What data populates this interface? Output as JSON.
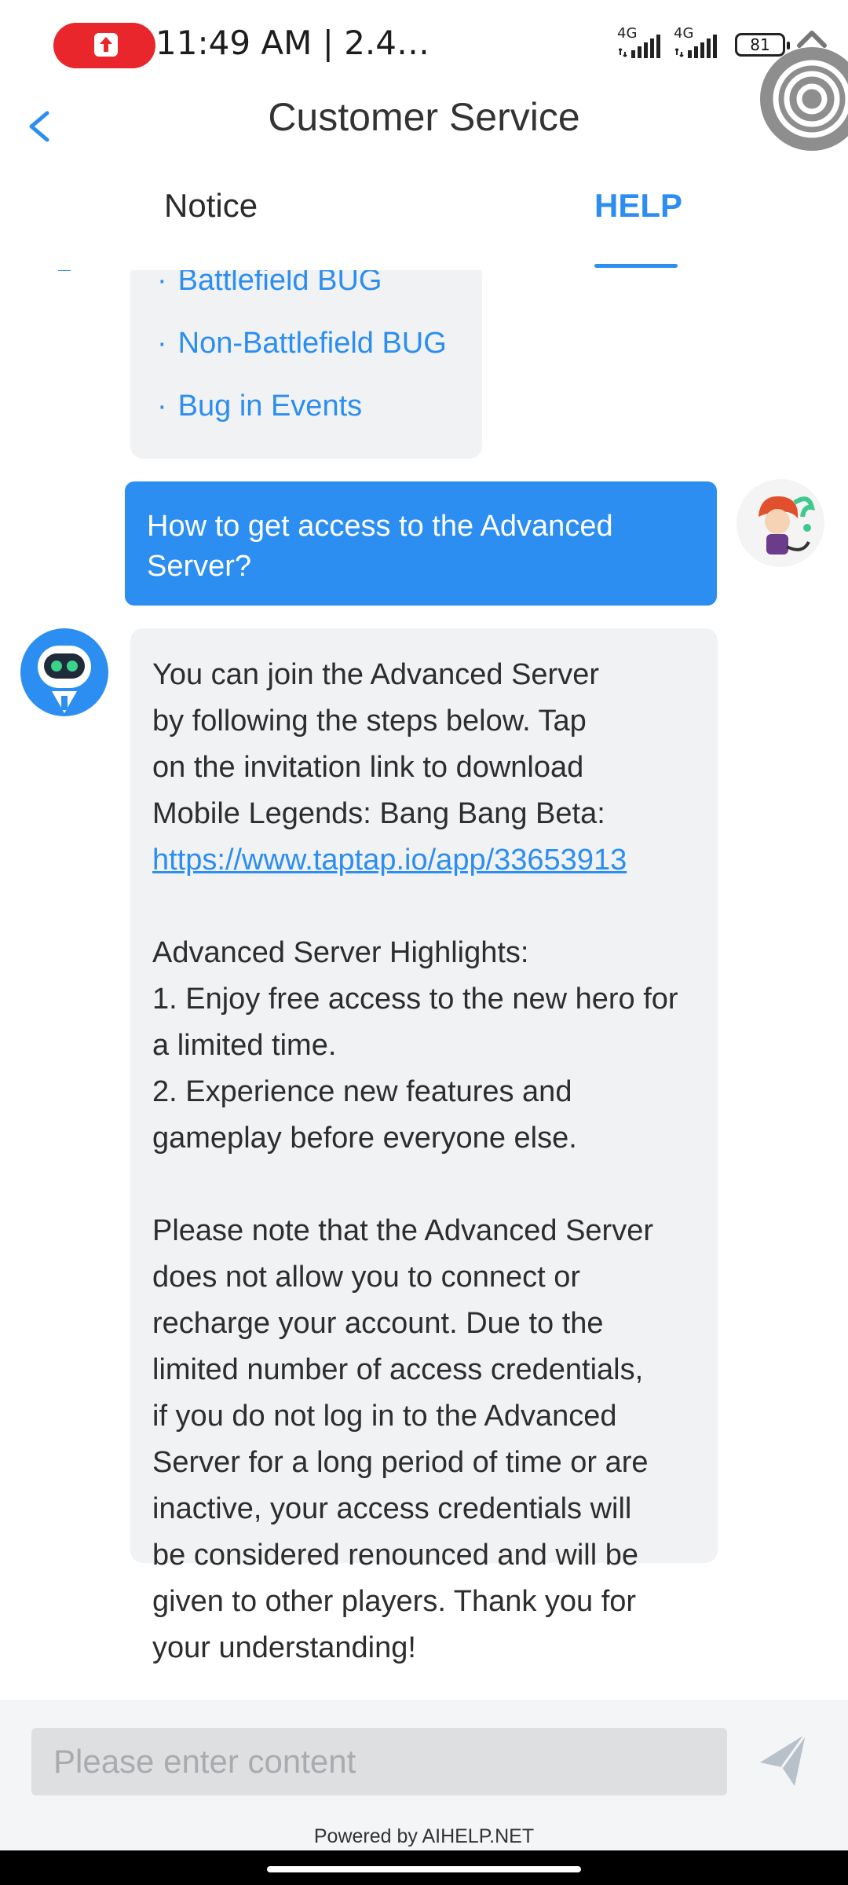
{
  "status_bar": {
    "time": "11:49 AM | 2.4…",
    "network_1": "4G",
    "network_2": "4G",
    "battery": "81"
  },
  "header": {
    "title": "Customer Service",
    "tabs": [
      {
        "label": "Notice",
        "active": false
      },
      {
        "label": "HELP",
        "active": true
      }
    ]
  },
  "chat": {
    "menu_items": [
      "Battlefield BUG",
      "Non-Battlefield BUG",
      "Bug in Events"
    ],
    "user_message": "How to get access to the Advanced Server?",
    "bot_message": {
      "intro_lines": [
        "You can join the Advanced Server",
        "by following the steps below. Tap",
        "on the invitation link to download",
        "Mobile Legends: Bang Bang Beta:"
      ],
      "link": "https://www.taptap.io/app/33653913",
      "highlights_title": "Advanced Server Highlights:",
      "highlights": [
        "1. Enjoy free access to the new hero for",
        "a limited time.",
        "2. Experience new features and",
        "gameplay before everyone else."
      ],
      "note_lines": [
        "Please note that the Advanced Server",
        "does not allow you to connect or",
        "recharge your account. Due to the",
        "limited number of access credentials,",
        "if you do not log in to the Advanced",
        "Server for a long period of time or are",
        "inactive, your access credentials will",
        "be considered renounced and will be",
        "given to other players. Thank you for",
        "your understanding!"
      ]
    }
  },
  "input": {
    "placeholder": "Please enter content",
    "value": ""
  },
  "footer": {
    "powered_by": "Powered by AIHELP.NET"
  },
  "colors": {
    "accent": "#2b8ef0",
    "bubble_gray": "#f1f2f4",
    "record_red": "#e8262b"
  },
  "icons": [
    "record-icon",
    "signal-icon",
    "battery-icon",
    "chevron-up-icon",
    "floating-assist-icon",
    "back-icon",
    "user-avatar-icon",
    "bot-avatar-icon",
    "send-icon"
  ]
}
